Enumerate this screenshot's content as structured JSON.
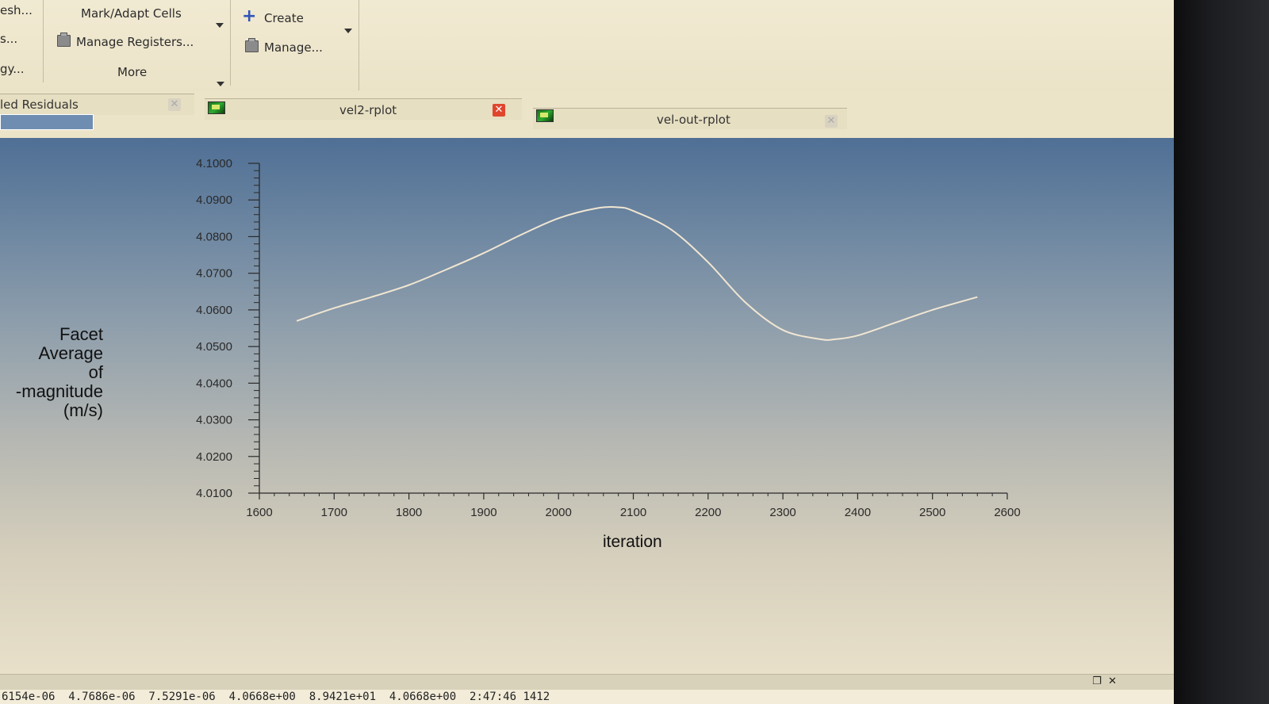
{
  "ribbon": {
    "left_items": [
      "esh...",
      "s...",
      "gy..."
    ],
    "mark_adapt": "Mark/Adapt Cells",
    "manage_registers": "Manage Registers...",
    "more": "More",
    "create": "Create",
    "manage": "Manage..."
  },
  "tabs": [
    {
      "title": "led Residuals"
    },
    {
      "title": "vel2-rplot"
    },
    {
      "title": "vel-out-rplot"
    }
  ],
  "chart_data": {
    "type": "line",
    "xlabel": "iteration",
    "ylabel_lines": [
      "Facet",
      "Average",
      "of",
      "-magnitude",
      "(m/s)"
    ],
    "x_ticks": [
      "1600",
      "1700",
      "1800",
      "1900",
      "2000",
      "2100",
      "2200",
      "2300",
      "2400",
      "2500",
      "2600"
    ],
    "y_ticks": [
      "4.0100",
      "4.0200",
      "4.0300",
      "4.0400",
      "4.0500",
      "4.0600",
      "4.0700",
      "4.0800",
      "4.0900",
      "4.1000"
    ],
    "xlim": [
      1600,
      2600
    ],
    "ylim": [
      4.01,
      4.1
    ],
    "line_color": "#f1e6d2",
    "series": [
      {
        "x": [
          1650,
          1700,
          1750,
          1800,
          1850,
          1900,
          1950,
          2000,
          2050,
          2080,
          2100,
          2150,
          2200,
          2250,
          2300,
          2350,
          2370,
          2400,
          2450,
          2500,
          2560
        ],
        "y": [
          4.057,
          4.0605,
          4.0635,
          4.0668,
          4.071,
          4.0755,
          4.0805,
          4.085,
          4.0877,
          4.088,
          4.087,
          4.082,
          4.073,
          4.062,
          4.0545,
          4.052,
          4.052,
          4.053,
          4.0565,
          4.06,
          4.0635
        ]
      }
    ]
  },
  "console": {
    "line": "6154e-06  4.7686e-06  7.5291e-06  4.0668e+00  8.9421e+01  4.0668e+00  2:47:46 1412"
  }
}
